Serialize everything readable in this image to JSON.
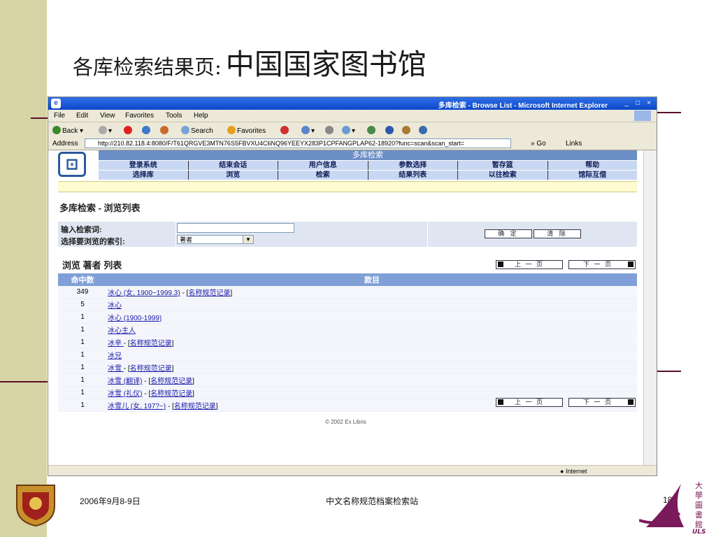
{
  "slide": {
    "title_part1": "各库检索结果页:",
    "title_part2": "中国国家图书馆",
    "footer_date": "2006年9月8-9日",
    "footer_center": "中文名称规范档案检索站",
    "page_number": "18",
    "logo_right_text": "大學圖書館",
    "logo_right_abbrev": "ULS"
  },
  "browser": {
    "window_title": "多库检索 - Browse List - Microsoft Internet Explorer",
    "menu": [
      "File",
      "Edit",
      "View",
      "Favorites",
      "Tools",
      "Help"
    ],
    "toolbar": {
      "back": "Back",
      "search": "Search",
      "favorites": "Favorites"
    },
    "address_label": "Address",
    "url": "http://210.82.118.4:8080/F/T61QRGVE3MTN76S5FBVXU4C6NQ96YEEYX283P1CPFANGPLAP62-18920?func=scan&scan_start=",
    "go": "Go",
    "links": "Links",
    "status_zone": "Internet"
  },
  "opac": {
    "header_title": "多库检索",
    "nav_row1": [
      "登录系统",
      "结束会话",
      "用户信息",
      "参数选择",
      "暂存篮",
      "帮助"
    ],
    "nav_row2": [
      "选择库",
      "浏览",
      "检索",
      "结果列表",
      "以往检索",
      "馆际互借"
    ],
    "page_heading": "多库检索  - 浏览列表",
    "form": {
      "search_label": "输入检索词:",
      "index_label": "选择要浏览的索引:",
      "index_value": "著者",
      "search_value": "",
      "confirm": "确 定",
      "clear": "清 除"
    },
    "browse_heading": "浏览  著者  列表",
    "prev_page": "上 一 页",
    "next_page": "下 一 页",
    "table_headers": {
      "hits": "命中数",
      "entry": "款目"
    },
    "rows": [
      {
        "hits": "349",
        "entry": "冰心 (女,  1900~1999.3)",
        "auth": "名称规范记录"
      },
      {
        "hits": "5",
        "entry": "冰心",
        "auth": ""
      },
      {
        "hits": "1",
        "entry": "冰心 (1900-1999)",
        "auth": ""
      },
      {
        "hits": "1",
        "entry": "冰心主人",
        "auth": ""
      },
      {
        "hits": "1",
        "entry": "冰辛 ",
        "auth": "名称规范记录"
      },
      {
        "hits": "1",
        "entry": "冰兄",
        "auth": ""
      },
      {
        "hits": "1",
        "entry": "冰雪 ",
        "auth": "名称规范记录"
      },
      {
        "hits": "1",
        "entry": "冰雪 (翻译)",
        "auth": "名称规范记录"
      },
      {
        "hits": "1",
        "entry": "冰雪 (礼仪)",
        "auth": "名称规范记录"
      },
      {
        "hits": "1",
        "entry": "冰雪儿 (女,  197?~)",
        "auth": "名称规范记录"
      }
    ],
    "copyright": "© 2002 Ex Libris"
  },
  "colors": {
    "left_band": "#d6d3a4",
    "rule": "#5a0f2c",
    "xp_title": "#0b47c8",
    "table_header": "#7f9fd6"
  }
}
